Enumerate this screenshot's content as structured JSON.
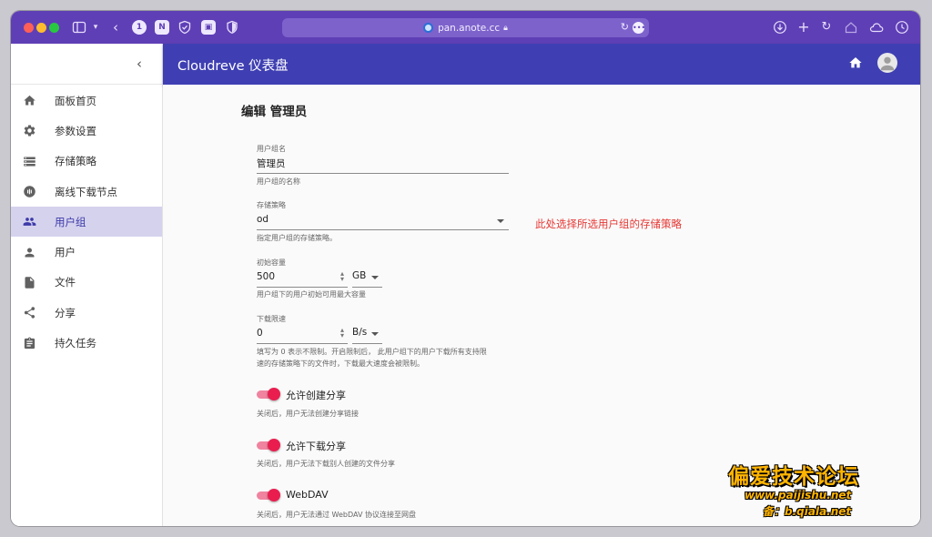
{
  "browser": {
    "url": "pan.anote.cc",
    "icons": [
      "sidebar-toggle-icon",
      "chevron-down-icon",
      "back-icon",
      "onepassword-icon",
      "notion-icon",
      "shield-icon",
      "bitwarden-icon",
      "privacy-icon",
      "download-icon",
      "new-tab-icon",
      "reload-icon",
      "home-icon",
      "cloud-icon",
      "history-icon"
    ]
  },
  "app": {
    "title": "Cloudreve 仪表盘"
  },
  "sidebar": {
    "items": [
      {
        "label": "面板首页",
        "icon": "home-icon"
      },
      {
        "label": "参数设置",
        "icon": "gear-icon"
      },
      {
        "label": "存储策略",
        "icon": "storage-icon"
      },
      {
        "label": "离线下载节点",
        "icon": "download-node-icon"
      },
      {
        "label": "用户组",
        "icon": "group-icon",
        "active": true
      },
      {
        "label": "用户",
        "icon": "person-icon"
      },
      {
        "label": "文件",
        "icon": "file-icon"
      },
      {
        "label": "分享",
        "icon": "share-icon"
      },
      {
        "label": "持久任务",
        "icon": "task-icon"
      }
    ]
  },
  "form": {
    "heading": "编辑 管理员",
    "group_name": {
      "label": "用户组名",
      "value": "管理员",
      "helper": "用户组的名称"
    },
    "policy": {
      "label": "存储策略",
      "value": "od",
      "helper": "指定用户组的存储策略。"
    },
    "capacity": {
      "label": "初始容量",
      "value": "500",
      "unit": "GB",
      "helper": "用户组下的用户初始可用最大容量"
    },
    "speed": {
      "label": "下载限速",
      "value": "0",
      "unit": "B/s",
      "helper_line1": "填写为 0 表示不限制。开启限制后， 此用户组下的用户下载所有支持限",
      "helper_line2": "速的存储策略下的文件时，下载最大速度会被限制。"
    },
    "switches": [
      {
        "label": "允许创建分享",
        "helper": "关闭后，用户无法创建分享链接",
        "on": true
      },
      {
        "label": "允许下载分享",
        "helper": "关闭后，用户无法下载别人创建的文件分享",
        "on": true
      },
      {
        "label": "WebDAV",
        "helper": "关闭后，用户无法通过 WebDAV 协议连接至网盘",
        "on": true
      }
    ]
  },
  "annotation": "此处选择所选用户组的存储策略",
  "watermark": {
    "title": "偏爱技术论坛",
    "url": "www.paijishu.net",
    "beian": "备：b.qiala.net"
  },
  "colors": {
    "browser_bar": "#5f3fb6",
    "app_header": "#3f3fb3",
    "active_nav": "#d5d2ee",
    "switch_on": "#e91e4f",
    "annotation": "#e53935",
    "watermark": "#ffb400"
  }
}
